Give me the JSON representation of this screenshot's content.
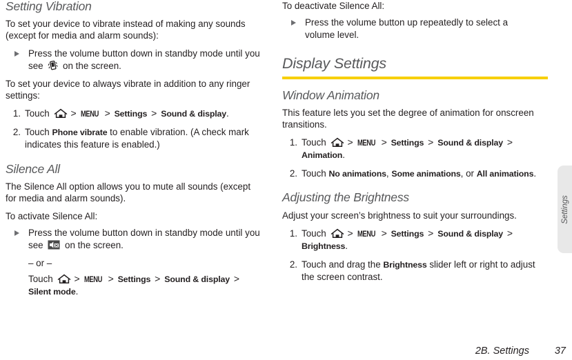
{
  "document": {
    "footer_chapter": "2B. Settings",
    "footer_page": "37",
    "side_tab_label": "Settings",
    "accent_color": "#f7cf00",
    "heading_color": "#58595b"
  },
  "left_column": {
    "section_vibration": {
      "heading": "Setting Vibration",
      "intro": "To set your device to vibrate instead of making any sounds (except for media and alarm sounds):",
      "bullet": {
        "text_before_icon": "Press the volume button down in standby mode until you see ",
        "icon": "vibrate-icon",
        "text_after_icon": " on the screen."
      },
      "second_intro": "To set your device to always vibrate in addition to any ringer settings:",
      "steps": [
        {
          "number": "1.",
          "prefix": "Touch ",
          "home_icon": "home-icon",
          "menu_icon": "MENU",
          "path": [
            "Settings",
            "Sound & display"
          ],
          "suffix": "."
        },
        {
          "number": "2.",
          "prefix": "Touch ",
          "bold": "Phone vibrate",
          "suffix": " to enable vibration. (A check mark indicates this feature is enabled.)"
        }
      ]
    },
    "section_silence": {
      "heading": "Silence All",
      "intro": "The Silence All option allows you to mute all sounds (except for media and alarm sounds).",
      "activate_label": "To activate Silence All:",
      "bullet": {
        "text_before_icon": "Press the volume button down in standby mode until you see ",
        "icon": "silent-icon",
        "text_after_icon": " on the screen."
      },
      "or_text": "– or –",
      "alt_touch": {
        "prefix": "Touch ",
        "home_icon": "home-icon",
        "menu_icon": "MENU",
        "path": [
          "Settings",
          "Sound & display",
          "Silent mode"
        ],
        "suffix": "."
      }
    }
  },
  "right_column": {
    "deactivate_label": "To deactivate Silence All:",
    "deactivate_bullet": "Press the volume button up repeatedly to select a volume level.",
    "chapter_heading": "Display Settings",
    "section_window_animation": {
      "heading": "Window Animation",
      "intro": "This feature lets you set the degree of animation for onscreen transitions.",
      "steps": [
        {
          "number": "1.",
          "prefix": "Touch ",
          "home_icon": "home-icon",
          "menu_icon": "MENU",
          "path": [
            "Settings",
            "Sound & display",
            "Animation"
          ],
          "suffix": "."
        },
        {
          "number": "2.",
          "prefix": "Touch ",
          "options": [
            "No animations",
            "Some animations",
            "All animations"
          ],
          "separator_1": ", ",
          "separator_2": ", or ",
          "suffix": "."
        }
      ]
    },
    "section_brightness": {
      "heading": "Adjusting the Brightness",
      "intro": "Adjust your screen’s brightness to suit your surroundings.",
      "steps": [
        {
          "number": "1.",
          "prefix": "Touch ",
          "home_icon": "home-icon",
          "menu_icon": "MENU",
          "path": [
            "Settings",
            "Sound & display",
            "Brightness"
          ],
          "suffix": "."
        },
        {
          "number": "2.",
          "prefix": "Touch and drag the ",
          "bold": "Brightness",
          "suffix": " slider left or right to adjust the screen contrast."
        }
      ]
    }
  }
}
